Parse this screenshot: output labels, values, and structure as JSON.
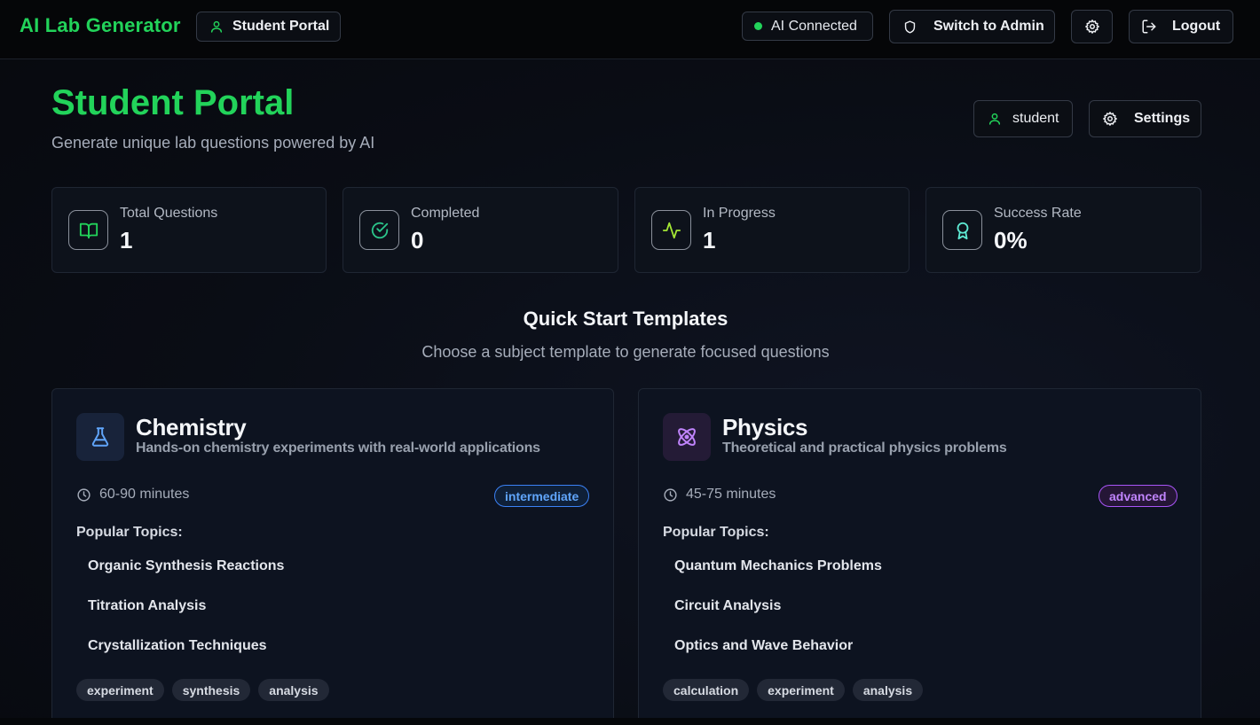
{
  "app": {
    "name": "AI Lab Generator",
    "portal_badge": "Student Portal"
  },
  "topbar": {
    "ai_status": "AI Connected",
    "switch_label": "Switch to Admin",
    "logout_label": "Logout"
  },
  "header": {
    "title": "Student Portal",
    "subtitle": "Generate unique lab questions powered by AI",
    "user_label": "student",
    "settings_label": "Settings"
  },
  "stats": [
    {
      "label": "Total Questions",
      "value": "1",
      "icon": "book-icon",
      "color": "#22d35a"
    },
    {
      "label": "Completed",
      "value": "0",
      "icon": "check-circle-icon",
      "color": "#2bc48a"
    },
    {
      "label": "In Progress",
      "value": "1",
      "icon": "activity-icon",
      "color": "#a3e635"
    },
    {
      "label": "Success Rate",
      "value": "0%",
      "icon": "award-icon",
      "color": "#5eead4"
    }
  ],
  "quick_start": {
    "title": "Quick Start Templates",
    "subtitle": "Choose a subject template to generate focused questions"
  },
  "templates": [
    {
      "title": "Chemistry",
      "description": "Hands-on chemistry experiments with real-world applications",
      "icon": "flask-icon",
      "duration": "60-90 minutes",
      "level": "intermediate",
      "level_color": "#60a5fa",
      "popular_label": "Popular Topics:",
      "topics": [
        "Organic Synthesis Reactions",
        "Titration Analysis",
        "Crystallization Techniques"
      ],
      "tags": [
        "experiment",
        "synthesis",
        "analysis"
      ]
    },
    {
      "title": "Physics",
      "description": "Theoretical and practical physics problems",
      "icon": "atom-icon",
      "duration": "45-75 minutes",
      "level": "advanced",
      "level_color": "#c084fc",
      "popular_label": "Popular Topics:",
      "topics": [
        "Quantum Mechanics Problems",
        "Circuit Analysis",
        "Optics and Wave Behavior"
      ],
      "tags": [
        "calculation",
        "experiment",
        "analysis"
      ]
    }
  ]
}
